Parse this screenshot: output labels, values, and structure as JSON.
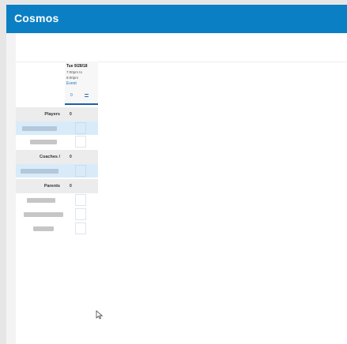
{
  "app": {
    "title": "Cosmos"
  },
  "event": {
    "date": "Tue 9/28/18",
    "time_start": "7:00pm to",
    "time_end": "8:00pm",
    "type": "Event",
    "count": "0",
    "icon": "list-icon"
  },
  "sections": [
    {
      "label": "Players",
      "count": "0"
    },
    {
      "label": "Coaches /",
      "count": "0"
    },
    {
      "label": "Parents",
      "count": "0"
    }
  ],
  "colors": {
    "header": "#0b7fc3",
    "highlight_row": "#d9ebf9",
    "link": "#1b74c2"
  }
}
